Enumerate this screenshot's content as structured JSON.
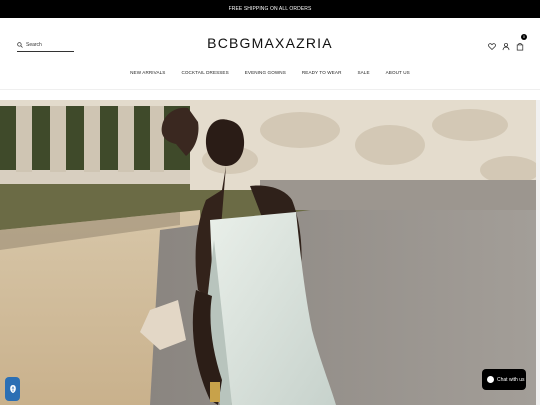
{
  "promo": {
    "text": "FREE SHIPPING ON ALL ORDERS"
  },
  "header": {
    "logo": "BCBGMAXAZRIA",
    "search_placeholder": "Search",
    "cart_count": "0"
  },
  "nav": {
    "items": [
      {
        "label": "NEW ARRIVALS"
      },
      {
        "label": "COCKTAIL DRESSES"
      },
      {
        "label": "EVENING GOWNS"
      },
      {
        "label": "READY TO WEAR"
      },
      {
        "label": "SALE"
      },
      {
        "label": "ABOUT US"
      }
    ]
  },
  "chat": {
    "label": "Chat with us"
  },
  "icons": {
    "search": "search-icon",
    "wishlist": "heart-icon",
    "account": "user-icon",
    "cart": "bag-icon",
    "accessibility": "accessibility-icon",
    "chat": "chat-icon"
  },
  "colors": {
    "promo_bg": "#000000",
    "chat_bg": "#000000",
    "a11y_bg": "#2b6fb4"
  }
}
